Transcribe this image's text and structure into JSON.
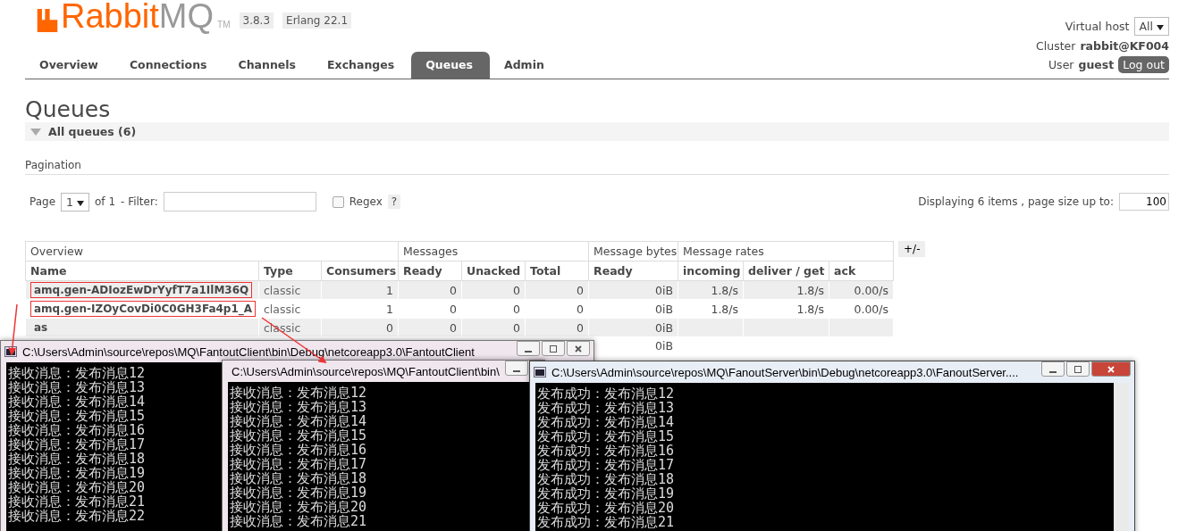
{
  "logo": {
    "part1": "Rabbit",
    "part2": "MQ",
    "tm": "TM"
  },
  "version": "3.8.3",
  "erlang": "Erlang 22.1",
  "header": {
    "vhost_label": "Virtual host",
    "vhost_value": "All",
    "cluster_label": "Cluster",
    "cluster_value": "rabbit@KF004",
    "user_label": "User",
    "user_value": "guest",
    "logout": "Log out"
  },
  "tabs": [
    {
      "label": "Overview",
      "selected": false
    },
    {
      "label": "Connections",
      "selected": false
    },
    {
      "label": "Channels",
      "selected": false
    },
    {
      "label": "Exchanges",
      "selected": false
    },
    {
      "label": "Queues",
      "selected": true
    },
    {
      "label": "Admin",
      "selected": false
    }
  ],
  "page_title": "Queues",
  "section": {
    "title": "All queues (6)",
    "expanded": true
  },
  "pagination": {
    "title": "Pagination",
    "page_label": "Page",
    "page_value": "1",
    "of": "of 1",
    "filter_label": "- Filter:",
    "regex": {
      "label": "Regex",
      "checked": false
    },
    "help": "?",
    "displaying": "Displaying 6 items , page size up to:",
    "page_size": "100"
  },
  "table": {
    "groups": [
      {
        "label": "Overview"
      },
      {
        "label": "Messages"
      },
      {
        "label": "Message bytes"
      },
      {
        "label": "Message rates"
      }
    ],
    "columns": [
      "Name",
      "Type",
      "Consumers",
      "Ready",
      "Unacked",
      "Total",
      "Ready",
      "incoming",
      "deliver / get",
      "ack"
    ],
    "toggle": "+/-",
    "rows": [
      {
        "name": "amq.gen-ADIozEwDrYyfT7a1IlM36Q",
        "highlighted": true,
        "type": "classic",
        "consumers": "1",
        "ready": "0",
        "unacked": "0",
        "total": "0",
        "bytes_ready": "0iB",
        "incoming": "1.8/s",
        "deliver_get": "1.8/s",
        "ack": "0.00/s"
      },
      {
        "name": "amq.gen-IZOyCovDi0C0GH3Fa4p1_A",
        "highlighted": true,
        "type": "classic",
        "consumers": "1",
        "ready": "0",
        "unacked": "0",
        "total": "0",
        "bytes_ready": "0iB",
        "incoming": "1.8/s",
        "deliver_get": "1.8/s",
        "ack": "0.00/s"
      },
      {
        "name": "as",
        "highlighted": false,
        "type": "classic",
        "consumers": "0",
        "ready": "0",
        "unacked": "0",
        "total": "0",
        "bytes_ready": "0iB"
      },
      {
        "bytes_ready": "0iB"
      }
    ]
  },
  "consoles": [
    {
      "title": "C:\\Users\\Admin\\source\\repos\\MQ\\FantoutClient\\bin\\Debug\\netcoreapp3.0\\FantoutClient",
      "active": false,
      "lines": [
        "接收消息：发布消息12",
        "接收消息：发布消息13",
        "接收消息：发布消息14",
        "接收消息：发布消息15",
        "接收消息：发布消息16",
        "接收消息：发布消息17",
        "接收消息：发布消息18",
        "接收消息：发布消息19",
        "接收消息：发布消息20",
        "接收消息：发布消息21",
        "接收消息：发布消息22"
      ]
    },
    {
      "title": "C:\\Users\\Admin\\source\\repos\\MQ\\FantoutClient\\bin\\",
      "active": false,
      "lines": [
        "接收消息：发布消息12",
        "接收消息：发布消息13",
        "接收消息：发布消息14",
        "接收消息：发布消息15",
        "接收消息：发布消息16",
        "接收消息：发布消息17",
        "接收消息：发布消息18",
        "接收消息：发布消息19",
        "接收消息：发布消息20",
        "接收消息：发布消息21"
      ]
    },
    {
      "title": "C:\\Users\\Admin\\source\\repos\\MQ\\FanoutServer\\bin\\Debug\\netcoreapp3.0\\FanoutServer....",
      "active": true,
      "lines": [
        "发布成功：发布消息12",
        "发布成功：发布消息13",
        "发布成功：发布消息14",
        "发布成功：发布消息15",
        "发布成功：发布消息16",
        "发布成功：发布消息17",
        "发布成功：发布消息18",
        "发布成功：发布消息19",
        "发布成功：发布消息20",
        "发布成功：发布消息21"
      ]
    }
  ]
}
